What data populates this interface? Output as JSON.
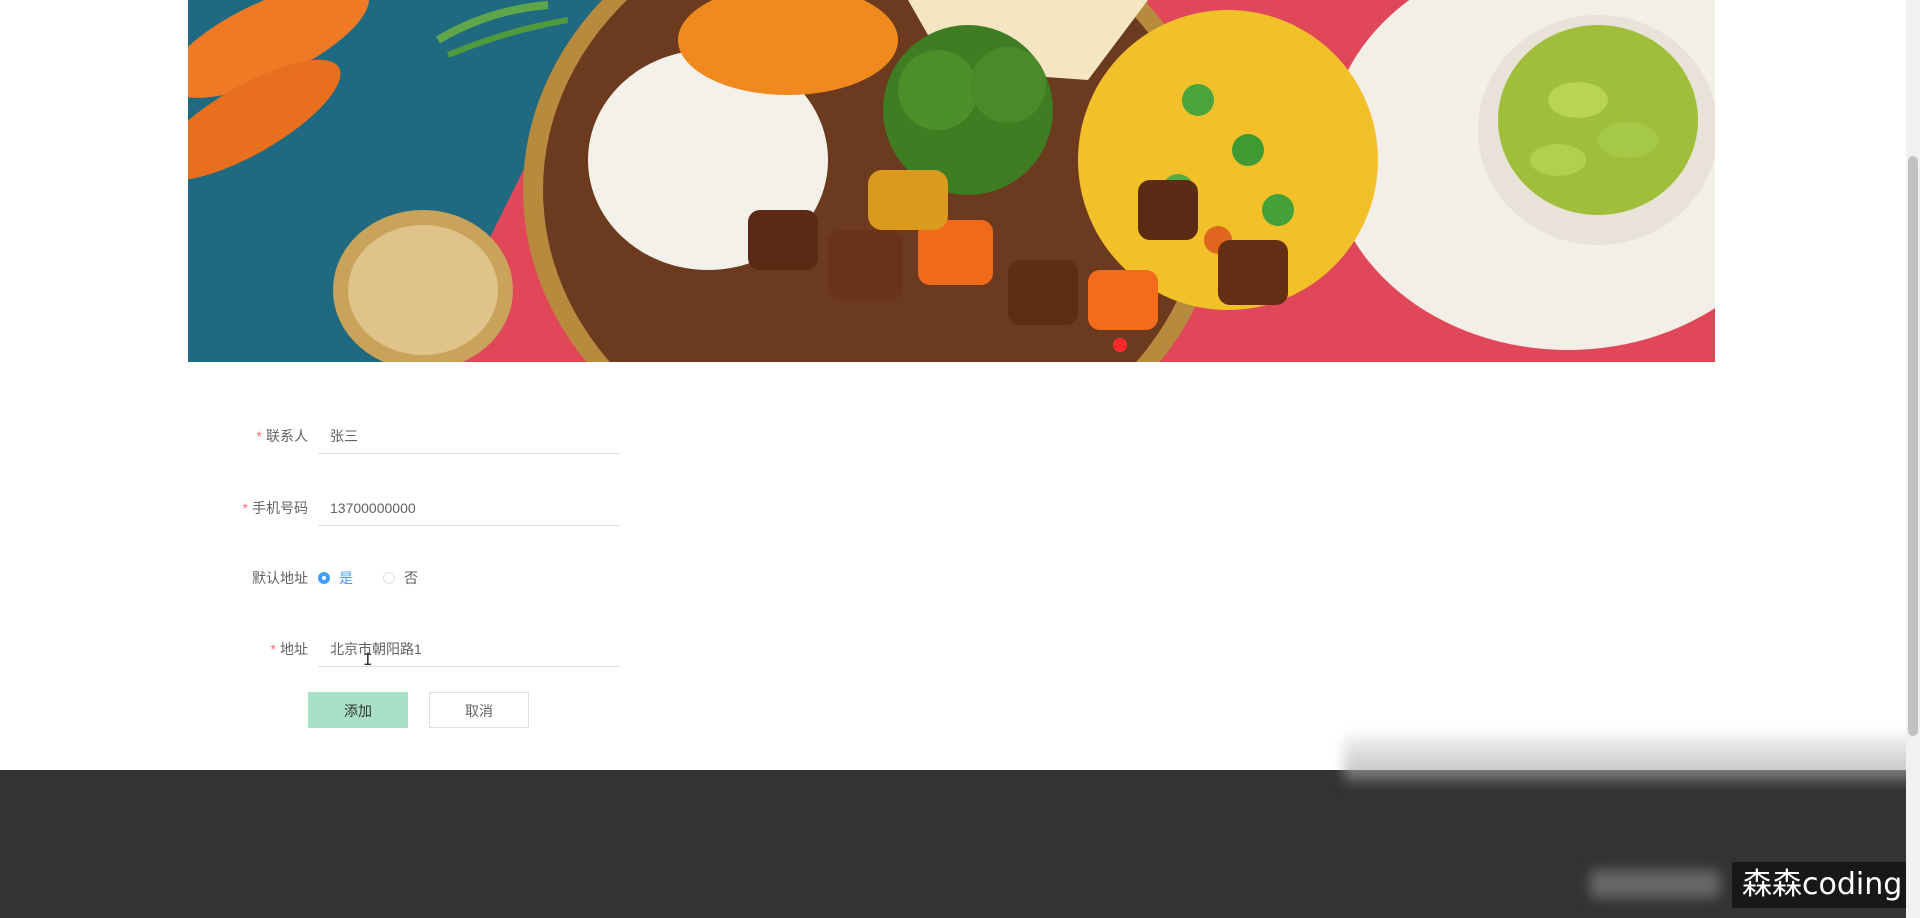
{
  "banner": {
    "active_slide_indicator_color": "#ff2a2a"
  },
  "form": {
    "contact": {
      "label": "联系人",
      "required": "*",
      "value": "张三"
    },
    "phone": {
      "label": "手机号码",
      "required": "*",
      "value": "13700000000"
    },
    "default_address": {
      "label": "默认地址",
      "options": [
        "是",
        "否"
      ],
      "selected": "是"
    },
    "address": {
      "label": "地址",
      "required": "*",
      "value": "北京市朝阳路1"
    },
    "buttons": {
      "add_label": "添加",
      "cancel_label": "取消"
    }
  },
  "watermark": {
    "text": "森森coding"
  },
  "colors": {
    "primary_button": "#a8e0c8",
    "radio_checked": "#409eff",
    "required_mark": "#f56c6c",
    "footer_bg": "#333333"
  }
}
